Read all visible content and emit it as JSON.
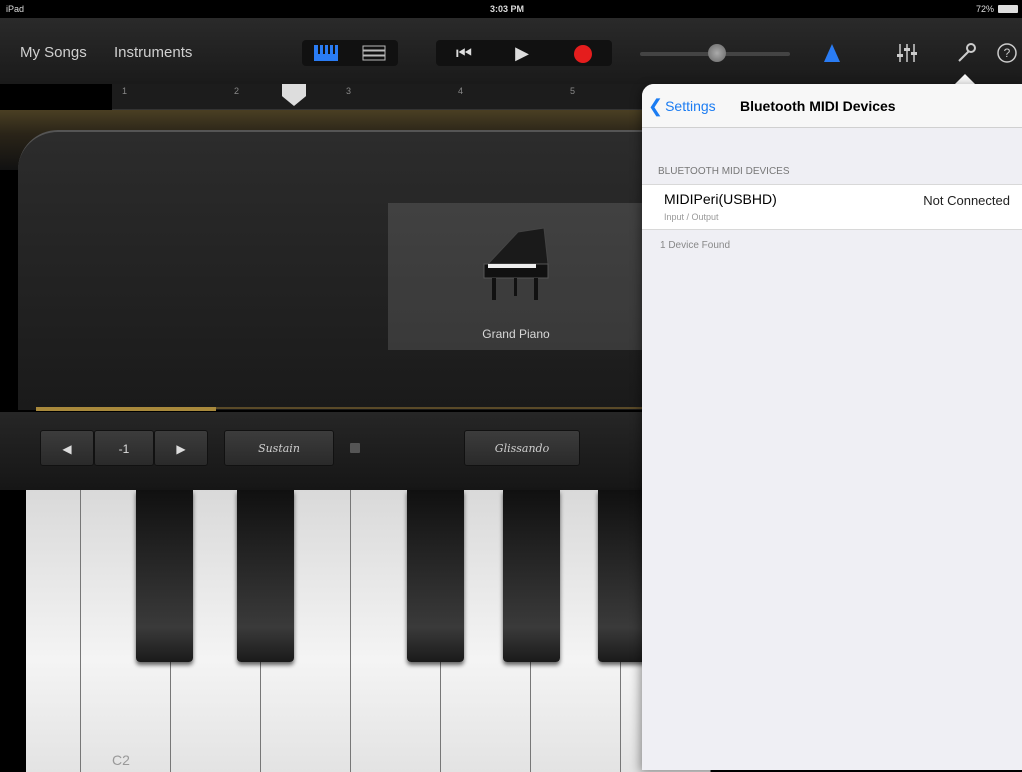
{
  "status_bar": {
    "device": "iPad",
    "time": "3:03 PM",
    "battery": "72%"
  },
  "toolbar": {
    "my_songs": "My Songs",
    "instruments": "Instruments",
    "rewind": "⏮",
    "play": "▶"
  },
  "ruler": {
    "bars": [
      "1",
      "2",
      "3",
      "4",
      "5"
    ]
  },
  "instrument": {
    "name": "Grand Piano"
  },
  "controls": {
    "octave_value": "-1",
    "sustain": "Sustain",
    "glissando": "Glissando"
  },
  "keyboard": {
    "note_label": "C2"
  },
  "popover": {
    "back_label": "Settings",
    "title": "Bluetooth MIDI Devices",
    "section_header": "BLUETOOTH MIDI DEVICES",
    "device": {
      "name": "MIDIPeri(USBHD)",
      "type": "Input / Output",
      "status": "Not Connected"
    },
    "footer": "1 Device Found"
  },
  "colors": {
    "accent": "#1b7cf2",
    "record": "#e51d1d",
    "gold": "#a8893c"
  },
  "icons": [
    "wifi-icon",
    "keyboard-view-icon",
    "tracks-view-icon",
    "rewind-icon",
    "play-icon",
    "record-icon",
    "metronome-icon",
    "mixer-icon",
    "wrench-icon",
    "help-icon",
    "lock-icon",
    "chevron-left-icon",
    "piano-icon"
  ]
}
